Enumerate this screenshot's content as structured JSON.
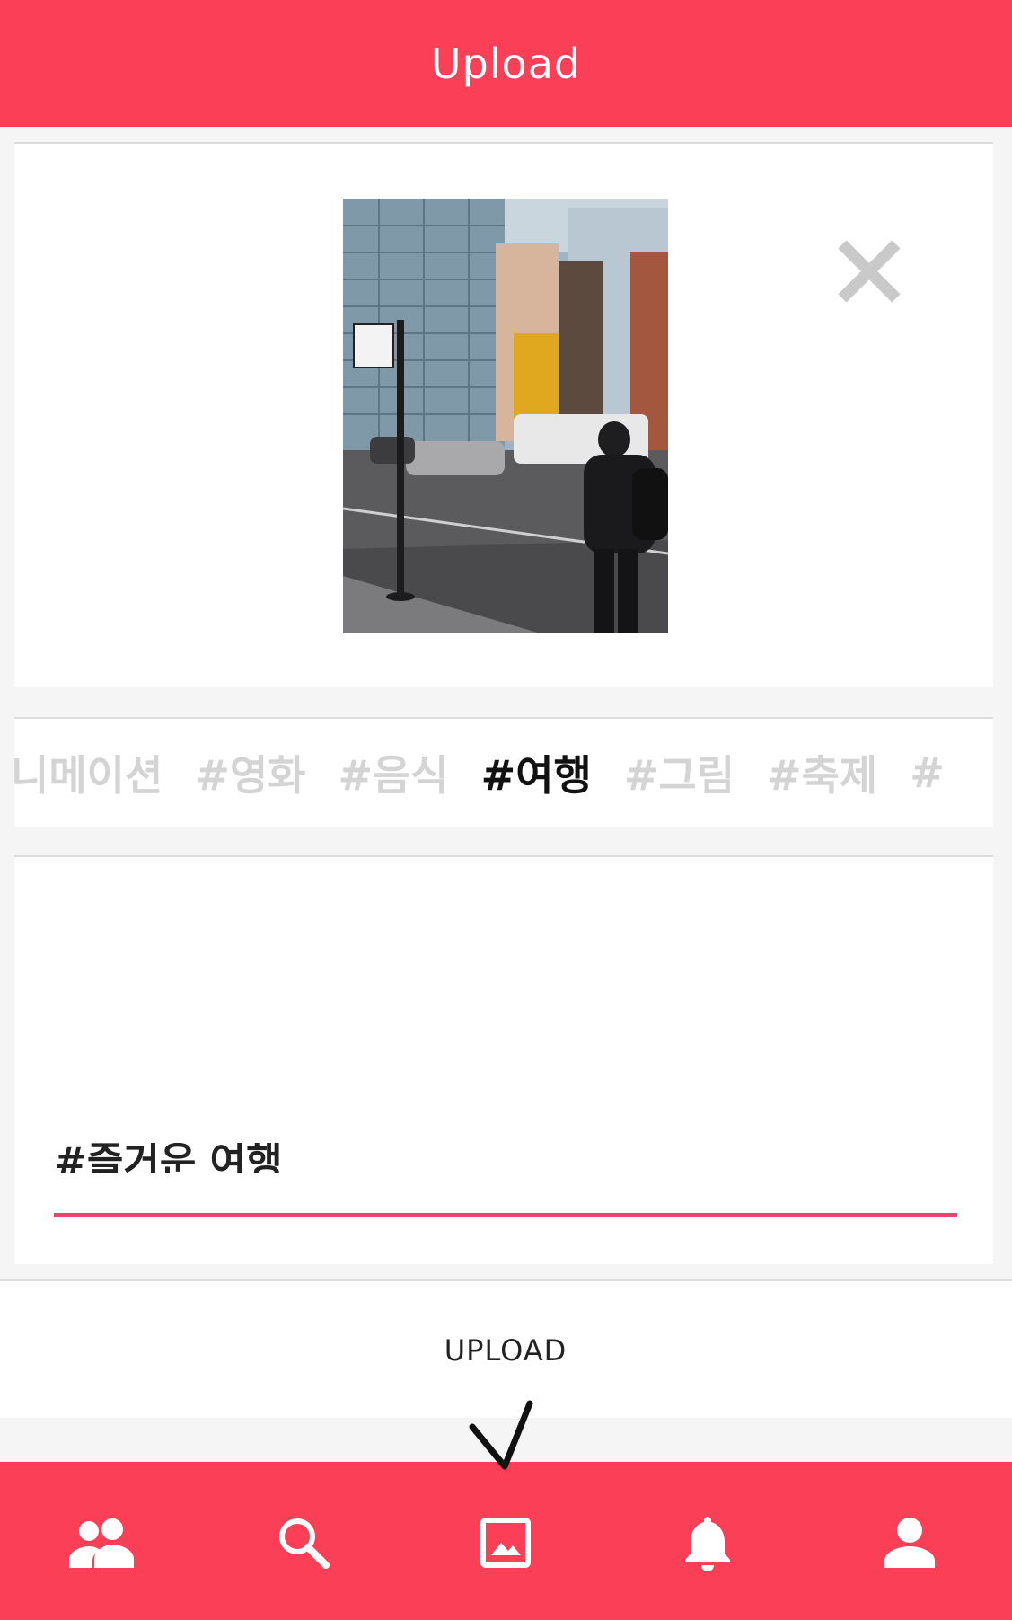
{
  "header": {
    "title": "Upload"
  },
  "photo_card": {
    "photo_icon": "street-photo",
    "close_icon": "close-icon"
  },
  "tags": {
    "items": [
      {
        "label": "니메이션",
        "active": false
      },
      {
        "label": "#영화",
        "active": false
      },
      {
        "label": "#음식",
        "active": false
      },
      {
        "label": "#여행",
        "active": true
      },
      {
        "label": "#그림",
        "active": false
      },
      {
        "label": "#축제",
        "active": false
      },
      {
        "label": "#",
        "active": false
      }
    ]
  },
  "caption": {
    "value": "#즐거운 여행"
  },
  "upload": {
    "label": "UPLOAD"
  },
  "bottom_nav": {
    "items": [
      {
        "icon": "people-icon"
      },
      {
        "icon": "search-icon"
      },
      {
        "icon": "image-icon",
        "active": true
      },
      {
        "icon": "bell-icon"
      },
      {
        "icon": "person-icon"
      }
    ]
  },
  "colors": {
    "accent": "#fb3f57",
    "underline": "#e8466e",
    "tag_inactive": "#d4d4d4"
  }
}
